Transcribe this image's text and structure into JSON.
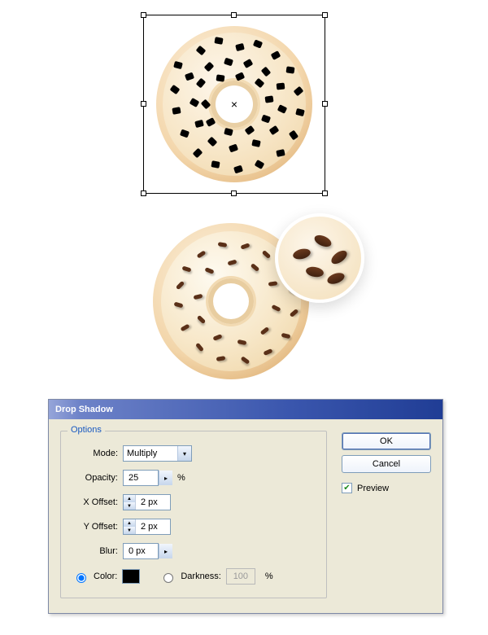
{
  "dialog": {
    "title": "Drop Shadow",
    "legend": "Options",
    "mode_label": "Mode:",
    "mode_value": "Multiply",
    "opacity_label": "Opacity:",
    "opacity_value": "25",
    "opacity_unit": "%",
    "xoffset_label": "X Offset:",
    "xoffset_value": "2 px",
    "yoffset_label": "Y Offset:",
    "yoffset_value": "2 px",
    "blur_label": "Blur:",
    "blur_value": "0 px",
    "color_label": "Color:",
    "color_value": "#000000",
    "darkness_label": "Darkness:",
    "darkness_value": "100",
    "darkness_unit": "%",
    "ok_label": "OK",
    "cancel_label": "Cancel",
    "preview_label": "Preview",
    "preview_checked": true,
    "color_selected": true,
    "darkness_selected": false
  }
}
